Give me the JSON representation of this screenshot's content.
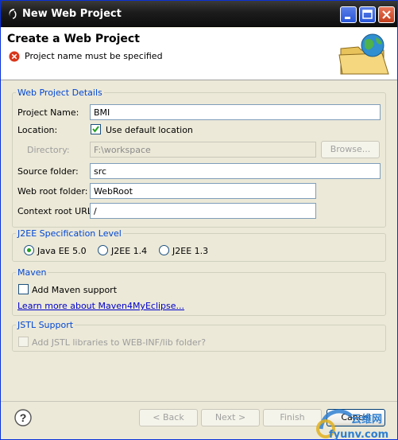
{
  "window": {
    "title": "New Web Project"
  },
  "header": {
    "page_title": "Create a Web Project",
    "error_message": "Project name must be specified"
  },
  "details": {
    "legend": "Web Project Details",
    "project_name_label": "Project Name:",
    "project_name_value": "BMI",
    "location_label": "Location:",
    "use_default_label": "Use default location",
    "use_default_checked": true,
    "directory_label": "Directory:",
    "directory_value": "F:\\workspace",
    "browse_label": "Browse...",
    "source_folder_label": "Source folder:",
    "source_folder_value": "src",
    "web_root_label": "Web root folder:",
    "web_root_value": "WebRoot",
    "context_root_label": "Context root URL:",
    "context_root_value": "/"
  },
  "j2ee": {
    "legend": "J2EE Specification Level",
    "options": [
      "Java EE 5.0",
      "J2EE 1.4",
      "J2EE 1.3"
    ],
    "selected": "Java EE 5.0"
  },
  "maven": {
    "legend": "Maven",
    "add_support_label": "Add Maven support",
    "learn_more_link": "Learn more about Maven4MyEclipse..."
  },
  "jstl": {
    "legend": "JSTL Support",
    "add_libs_label": "Add JSTL libraries to WEB-INF/lib folder?"
  },
  "footer": {
    "back_label": "< Back",
    "next_label": "Next >",
    "finish_label": "Finish",
    "cancel_label": "Cancel"
  },
  "watermark": {
    "text_top": "云维网",
    "text_bottom": "fyunv.com"
  },
  "colors": {
    "titlebar": "#1c1c1c",
    "legend": "#0046d5",
    "link": "#0000cc",
    "error": "#d9361a"
  },
  "icons": [
    "eclipse-icon",
    "minimize-icon",
    "maximize-icon",
    "close-icon",
    "error-icon",
    "folder-globe-icon",
    "help-icon"
  ]
}
